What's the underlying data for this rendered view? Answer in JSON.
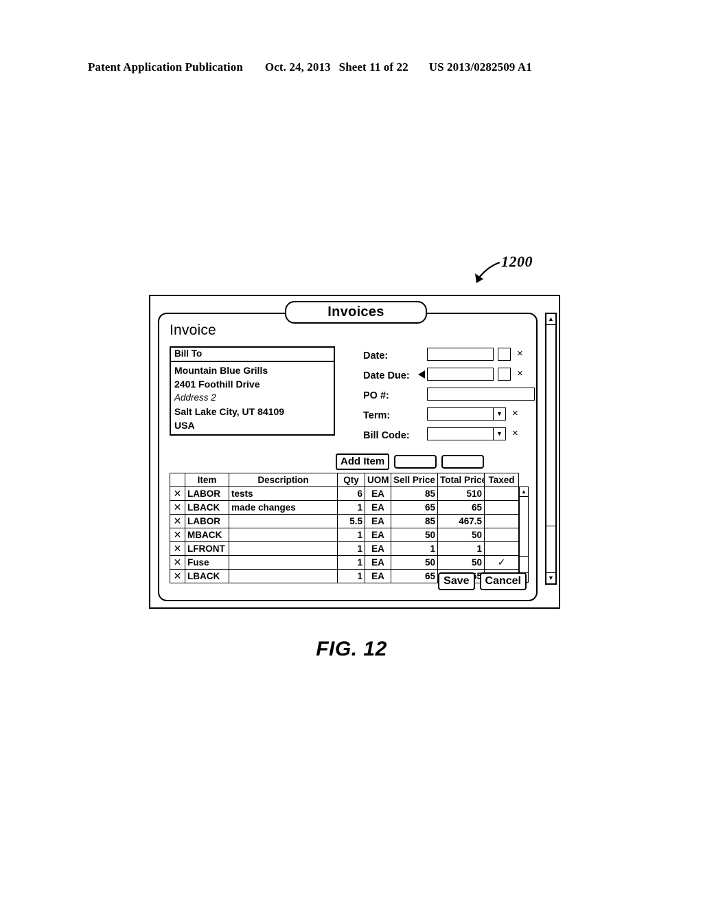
{
  "patent_header": {
    "publication": "Patent Application Publication",
    "date": "Oct. 24, 2013",
    "sheet": "Sheet 11 of 22",
    "number": "US 2013/0282509 A1"
  },
  "figure": {
    "label": "FIG. 12",
    "callout_number": "1200"
  },
  "window": {
    "tab_label": "Invoices",
    "panel_title": "Invoice"
  },
  "bill_to": {
    "header": "Bill To",
    "lines": [
      {
        "text": "Mountain Blue Grills",
        "placeholder": false
      },
      {
        "text": "2401 Foothill Drive",
        "placeholder": false
      },
      {
        "text": "Address 2",
        "placeholder": true
      },
      {
        "text": "Salt Lake City, UT 84109",
        "placeholder": false
      },
      {
        "text": "USA",
        "placeholder": false
      }
    ]
  },
  "form": {
    "date_label": "Date:",
    "date_value": "",
    "date_due_label": "Date Due:",
    "date_due_value": "",
    "po_label": "PO #:",
    "po_value": "",
    "term_label": "Term:",
    "term_value": "",
    "bill_code_label": "Bill Code:",
    "bill_code_value": "",
    "clear_glyph": "×",
    "dropdown_glyph": "▼"
  },
  "add_item": {
    "button_label": "Add Item",
    "field_1_value": "",
    "field_2_value": ""
  },
  "items_table": {
    "columns": [
      "",
      "Item",
      "Description",
      "Qty",
      "UOM",
      "Sell Price",
      "Total Price",
      "Taxed"
    ],
    "delete_glyph": "✕",
    "checked_glyph": "✓",
    "rows": [
      {
        "item": "LABOR",
        "description": "tests",
        "qty": "6",
        "uom": "EA",
        "sell_price": "85",
        "total_price": "510",
        "taxed": false
      },
      {
        "item": "LBACK",
        "description": "made changes",
        "qty": "1",
        "uom": "EA",
        "sell_price": "65",
        "total_price": "65",
        "taxed": false
      },
      {
        "item": "LABOR",
        "description": "",
        "qty": "5.5",
        "uom": "EA",
        "sell_price": "85",
        "total_price": "467.5",
        "taxed": false
      },
      {
        "item": "MBACK",
        "description": "",
        "qty": "1",
        "uom": "EA",
        "sell_price": "50",
        "total_price": "50",
        "taxed": false
      },
      {
        "item": "LFRONT",
        "description": "",
        "qty": "1",
        "uom": "EA",
        "sell_price": "1",
        "total_price": "1",
        "taxed": false
      },
      {
        "item": "Fuse",
        "description": "",
        "qty": "1",
        "uom": "EA",
        "sell_price": "50",
        "total_price": "50",
        "taxed": true
      },
      {
        "item": "LBACK",
        "description": "",
        "qty": "1",
        "uom": "EA",
        "sell_price": "65",
        "total_price": "65",
        "taxed": false
      }
    ]
  },
  "scrollbars": {
    "up_glyph": "▲",
    "down_glyph": "▼"
  },
  "actions": {
    "save_label": "Save",
    "cancel_label": "Cancel"
  },
  "colors": {
    "ink": "#000000",
    "paper": "#ffffff"
  }
}
